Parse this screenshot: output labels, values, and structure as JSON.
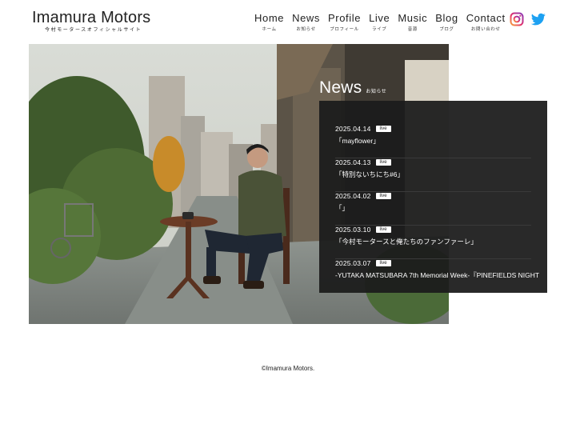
{
  "site": {
    "title": "Imamura Motors",
    "subtitle": "今村モータースオフィシャルサイト"
  },
  "nav": {
    "items": [
      {
        "en": "Home",
        "ja": "ホーム"
      },
      {
        "en": "News",
        "ja": "お知らせ"
      },
      {
        "en": "Profile",
        "ja": "プロフィール"
      },
      {
        "en": "Live",
        "ja": "ライブ"
      },
      {
        "en": "Music",
        "ja": "音源"
      },
      {
        "en": "Blog",
        "ja": "ブログ"
      },
      {
        "en": "Contact",
        "ja": "お問い合わせ"
      }
    ]
  },
  "social": {
    "instagram_icon": "instagram-icon",
    "twitter_icon": "twitter-icon",
    "instagram_color": "#d6246e",
    "twitter_color": "#1da1f2"
  },
  "news": {
    "heading_en": "News",
    "heading_ja": "お知らせ",
    "items": [
      {
        "date": "2025.04.14",
        "tag": "live",
        "title": "「mayflower」"
      },
      {
        "date": "2025.04.13",
        "tag": "live",
        "title": "「特別ないちにち#6」"
      },
      {
        "date": "2025.04.02",
        "tag": "live",
        "title": "「」"
      },
      {
        "date": "2025.03.10",
        "tag": "live",
        "title": "「今村モータースと俺たちのファンファーレ」"
      },
      {
        "date": "2025.03.07",
        "tag": "live",
        "title": "-YUTAKA MATSUBARA 7th Memorial Week-『PINEFIELDS NIGHT"
      }
    ]
  },
  "footer": {
    "copyright": "©Imamura Motors."
  }
}
